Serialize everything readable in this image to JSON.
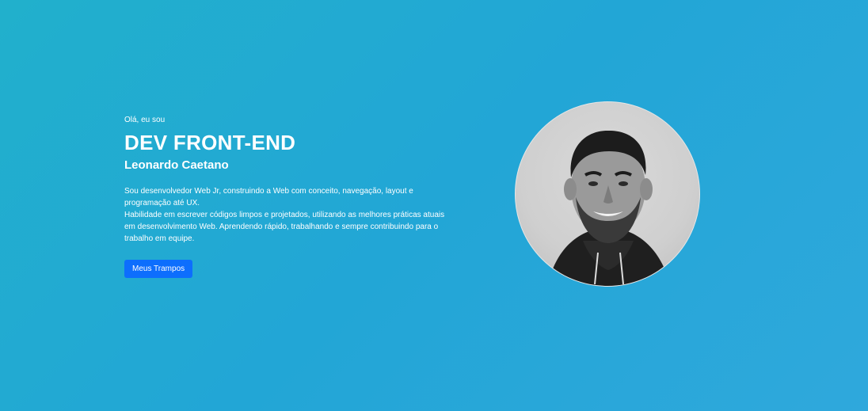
{
  "hero": {
    "greeting": "Olá, eu sou",
    "headline": "DEV FRONT-END",
    "name": "Leonardo Caetano",
    "bio": [
      "Sou desenvolvedor Web Jr, construindo a Web com conceito, navegação, layout e programação até UX.",
      "Habilidade em escrever códigos limpos e projetados, utilizando as melhores práticas atuais em desenvolvimento Web. Aprendendo rápido, trabalhando e sempre contribuindo para o trabalho em equipe."
    ],
    "cta_label": "Meus Trampos"
  },
  "colors": {
    "background_start": "#21b0cc",
    "background_end": "#2fa8dc",
    "button": "#0d6efd",
    "text": "#ffffff"
  }
}
